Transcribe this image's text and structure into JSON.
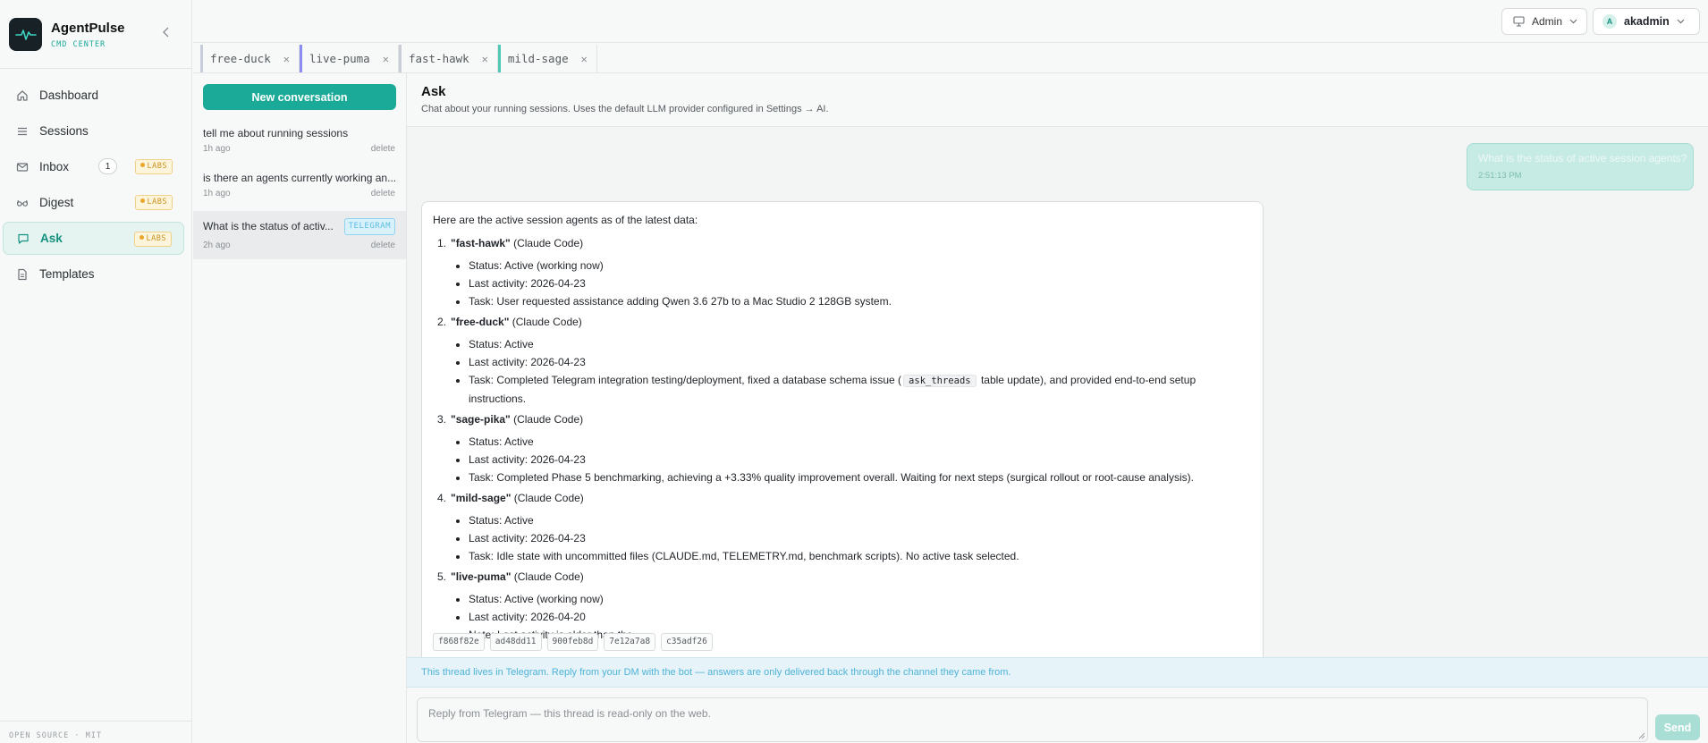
{
  "brand": {
    "name": "AgentPulse",
    "subtitle": "CMD CENTER"
  },
  "nav": {
    "items": [
      {
        "label": "Dashboard",
        "icon": "home-icon"
      },
      {
        "label": "Sessions",
        "icon": "list-icon"
      },
      {
        "label": "Inbox",
        "icon": "mail-icon",
        "count": "1",
        "badge": "LABS"
      },
      {
        "label": "Digest",
        "icon": "glasses-icon",
        "badge": "LABS"
      },
      {
        "label": "Ask",
        "icon": "chat-icon",
        "badge": "LABS",
        "active": true
      },
      {
        "label": "Templates",
        "icon": "file-icon"
      }
    ]
  },
  "footer": "OPEN SOURCE · MIT",
  "topbar": {
    "admin_label": "Admin",
    "user_initial": "A",
    "user_name": "akadmin"
  },
  "tabs": [
    {
      "name": "free-duck",
      "color": "#c9cddb"
    },
    {
      "name": "live-puma",
      "color": "#8b8cf0"
    },
    {
      "name": "fast-hawk",
      "color": "#c9cdd6"
    },
    {
      "name": "mild-sage",
      "color": "#4ec9b5"
    }
  ],
  "conversations": {
    "new_label": "New conversation",
    "delete_label": "delete",
    "items": [
      {
        "title": "tell me about running sessions",
        "time": "1h ago"
      },
      {
        "title": "is there an agents currently working an...",
        "time": "1h ago"
      },
      {
        "title": "What is the status of activ...",
        "time": "2h ago",
        "badge": "TELEGRAM",
        "active": true
      }
    ]
  },
  "main": {
    "title": "Ask",
    "subtitle": "Chat about your running sessions. Uses the default LLM provider configured in Settings → AI.",
    "user_message": {
      "text": "What is the status of active session agents?",
      "time": "2:51:13 PM"
    },
    "reply": {
      "intro": "Here are the active session agents as of the latest data:",
      "agents": [
        {
          "num": "1.",
          "name": "\"fast-hawk\"",
          "tool": "(Claude Code)",
          "bullets": [
            "Status: Active (working now)",
            "Last activity: 2026-04-23",
            "Task: User requested assistance adding Qwen 3.6 27b to a Mac Studio 2 128GB system."
          ]
        },
        {
          "num": "2.",
          "name": "\"free-duck\"",
          "tool": "(Claude Code)",
          "bullets": [
            "Status: Active",
            "Last activity: 2026-04-23"
          ],
          "task_pre": "Task: Completed Telegram integration testing/deployment, fixed a database schema issue (",
          "task_code": "ask_threads",
          "task_post": "table update), and provided end-to-end setup instructions."
        },
        {
          "num": "3.",
          "name": "\"sage-pika\"",
          "tool": "(Claude Code)",
          "bullets": [
            "Status: Active",
            "Last activity: 2026-04-23",
            "Task: Completed Phase 5 benchmarking, achieving a +3.33% quality improvement overall. Waiting for next steps (surgical rollout or root-cause analysis)."
          ]
        },
        {
          "num": "4.",
          "name": "\"mild-sage\"",
          "tool": "(Claude Code)",
          "bullets": [
            "Status: Active",
            "Last activity: 2026-04-23",
            "Task: Idle state with uncommitted files (CLAUDE.md, TELEMETRY.md, benchmark scripts). No active task selected."
          ]
        },
        {
          "num": "5.",
          "name": "\"live-puma\"",
          "tool": "(Claude Code)",
          "bullets": [
            "Status: Active (working now)",
            "Last activity: 2026-04-20",
            "Note: Last activity is older than the"
          ]
        }
      ],
      "refs": [
        "f868f82e",
        "ad48dd11",
        "900feb8d",
        "7e12a7a8",
        "c35adf26"
      ]
    },
    "notice": "This thread lives in Telegram. Reply from your DM with the bot — answers are only delivered back through the channel they came from.",
    "reply_placeholder": "Reply from Telegram — this thread is read-only on the web.",
    "send_label": "Send"
  }
}
